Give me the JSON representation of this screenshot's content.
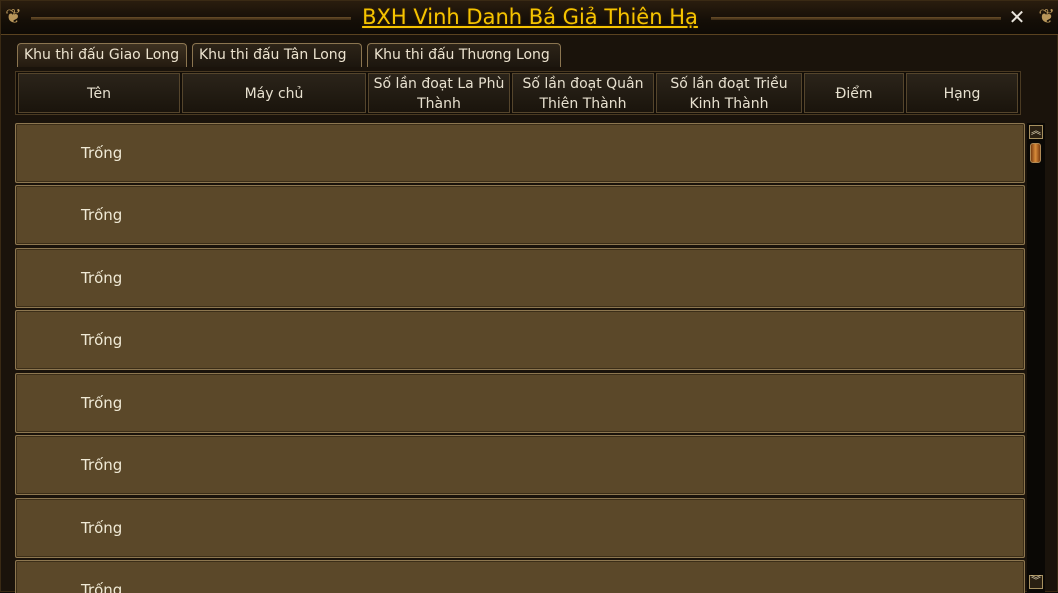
{
  "window": {
    "title": "BXH Vinh Danh Bá Giả Thiên Hạ",
    "close_label": "✕"
  },
  "tabs": [
    {
      "label": "Khu thi đấu Giao Long",
      "active": true
    },
    {
      "label": "Khu thi đấu Tân Long",
      "active": false
    },
    {
      "label": "Khu thi đấu Thương Long",
      "active": false
    }
  ],
  "table": {
    "columns": [
      {
        "label": "Tên"
      },
      {
        "label": "Máy chủ"
      },
      {
        "label_line1": "Số lần đoạt La Phù",
        "label_line2": "Thành"
      },
      {
        "label_line1": "Số lần đoạt Quân",
        "label_line2": "Thiên Thành"
      },
      {
        "label_line1": "Số lần đoạt Triều",
        "label_line2": "Kinh Thành"
      },
      {
        "label": "Điểm"
      },
      {
        "label": "Hạng"
      }
    ],
    "rows": [
      {
        "name": "Trống"
      },
      {
        "name": "Trống"
      },
      {
        "name": "Trống"
      },
      {
        "name": "Trống"
      },
      {
        "name": "Trống"
      },
      {
        "name": "Trống"
      },
      {
        "name": "Trống"
      },
      {
        "name": "Trống"
      }
    ]
  },
  "scrollbar": {
    "up_icon": "double-chevron-up-icon",
    "down_icon": "double-chevron-down-icon"
  },
  "colors": {
    "title": "#f5c400",
    "row_bg": "#5b4829",
    "row_border": "#8d7750"
  }
}
